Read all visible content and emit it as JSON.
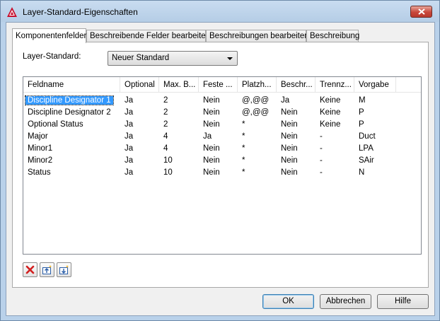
{
  "window": {
    "title": "Layer-Standard-Eigenschaften"
  },
  "tabs": [
    {
      "label": "Komponentenfelder"
    },
    {
      "label": "Beschreibende Felder bearbeiten"
    },
    {
      "label": "Beschreibungen bearbeiten"
    },
    {
      "label": "Beschreibung"
    }
  ],
  "layer_standard": {
    "label": "Layer-Standard:",
    "value": "Neuer Standard"
  },
  "table": {
    "columns": [
      "Feldname",
      "Optional",
      "Max. B...",
      "Feste ...",
      "Platzh...",
      "Beschr...",
      "Trennz...",
      "Vorgabe"
    ],
    "rows": [
      [
        "Discipline Designator 1",
        "Ja",
        "2",
        "Nein",
        "@,@@",
        "Ja",
        "Keine",
        "M"
      ],
      [
        "Discipline Designator 2",
        "Ja",
        "2",
        "Nein",
        "@,@@",
        "Nein",
        "Keine",
        "P"
      ],
      [
        "Optional Status",
        "Ja",
        "2",
        "Nein",
        "*",
        "Nein",
        "Keine",
        "P"
      ],
      [
        "Major",
        "Ja",
        "4",
        "Ja",
        "*",
        "Nein",
        "-",
        "Duct"
      ],
      [
        "Minor1",
        "Ja",
        "4",
        "Nein",
        "*",
        "Nein",
        "-",
        "LPA"
      ],
      [
        "Minor2",
        "Ja",
        "10",
        "Nein",
        "*",
        "Nein",
        "-",
        "SAir"
      ],
      [
        "Status",
        "Ja",
        "10",
        "Nein",
        "*",
        "Nein",
        "-",
        "N"
      ]
    ],
    "selected_row": 0
  },
  "toolbar": {
    "delete_icon": "delete-x-icon",
    "move_up_icon": "move-up-icon",
    "move_down_icon": "move-down-icon"
  },
  "buttons": {
    "ok": "OK",
    "cancel": "Abbrechen",
    "help": "Hilfe"
  },
  "colors": {
    "selection": "#3399ff",
    "close_button": "#c8473a",
    "app_icon": "#c8102e"
  }
}
